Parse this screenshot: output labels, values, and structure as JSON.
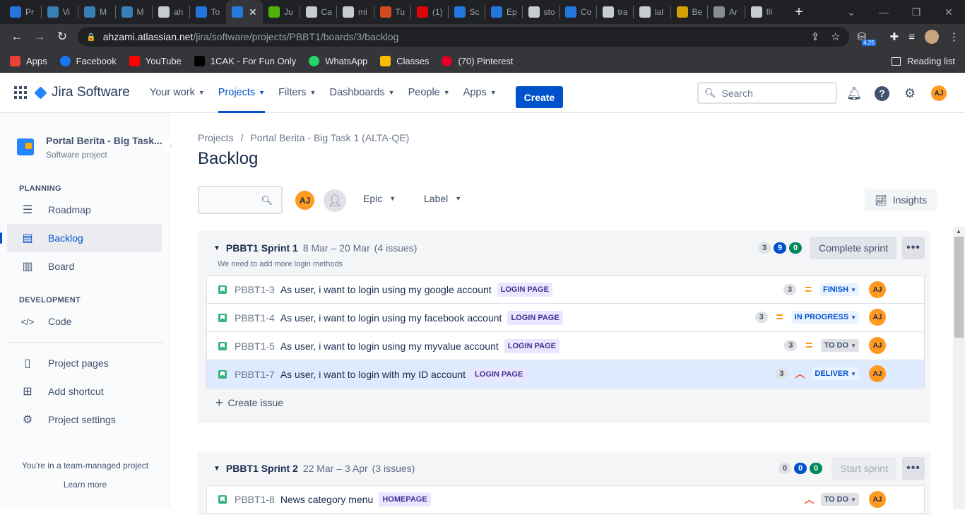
{
  "browser": {
    "tabs": [
      {
        "label": "Pr",
        "icon": "jira-icon",
        "color": "#2684ff"
      },
      {
        "label": "Vi",
        "icon": "m-icon",
        "color": "#3b8fd1"
      },
      {
        "label": "M",
        "icon": "m-icon",
        "color": "#3b8fd1"
      },
      {
        "label": "M",
        "icon": "m-icon",
        "color": "#3b8fd1"
      },
      {
        "label": "ah",
        "icon": "github-icon",
        "color": "#e8eaed"
      },
      {
        "label": "To",
        "icon": "jira-icon",
        "color": "#2684ff"
      },
      {
        "label": "",
        "icon": "jira-icon",
        "color": "#2684ff",
        "active": true
      },
      {
        "label": "Ju",
        "icon": "owl-icon",
        "color": "#58cc02"
      },
      {
        "label": "Ca",
        "icon": "check-icon",
        "color": "#e8eaed"
      },
      {
        "label": "mi",
        "icon": "google-icon",
        "color": "#e8eaed"
      },
      {
        "label": "Tu",
        "icon": "microsoft-icon",
        "color": "#f25022"
      },
      {
        "label": "(1)",
        "icon": "youtube-icon",
        "color": "#ff0000"
      },
      {
        "label": "Sc",
        "icon": "atlassian-icon",
        "color": "#2684ff"
      },
      {
        "label": "Ep",
        "icon": "atlassian-icon",
        "color": "#2684ff"
      },
      {
        "label": "sto",
        "icon": "google-icon",
        "color": "#e8eaed"
      },
      {
        "label": "Co",
        "icon": "atlassian-icon",
        "color": "#2684ff"
      },
      {
        "label": "tra",
        "icon": "google-icon",
        "color": "#e8eaed"
      },
      {
        "label": "lal",
        "icon": "google-icon",
        "color": "#e8eaed"
      },
      {
        "label": "Be",
        "icon": "face-icon",
        "color": "#f4b400"
      },
      {
        "label": "Ar",
        "icon": "globe-icon",
        "color": "#9aa0a6"
      },
      {
        "label": "fil",
        "icon": "google-icon",
        "color": "#e8eaed"
      }
    ],
    "url_host": "ahzami.atlassian.net",
    "url_path": "/jira/software/projects/PBBT1/boards/3/backlog",
    "ext_badge": "4.25",
    "bookmarks": [
      {
        "label": "Apps",
        "icon": "apps-grid-icon",
        "color": "#ea4335"
      },
      {
        "label": "Facebook",
        "icon": "facebook-icon",
        "color": "#1877f2"
      },
      {
        "label": "YouTube",
        "icon": "youtube-icon",
        "color": "#ff0000"
      },
      {
        "label": "1CAK - For Fun Only",
        "icon": "1cak-icon",
        "color": "#000000"
      },
      {
        "label": "WhatsApp",
        "icon": "whatsapp-icon",
        "color": "#25d366"
      },
      {
        "label": "Classes",
        "icon": "classroom-icon",
        "color": "#fbbc04"
      },
      {
        "label": "(70) Pinterest",
        "icon": "pinterest-icon",
        "color": "#e60023"
      }
    ],
    "reading_list": "Reading list"
  },
  "topnav": {
    "product": "Jira Software",
    "menu": [
      {
        "label": "Your work",
        "active": false
      },
      {
        "label": "Projects",
        "active": true
      },
      {
        "label": "Filters",
        "active": false
      },
      {
        "label": "Dashboards",
        "active": false
      },
      {
        "label": "People",
        "active": false
      },
      {
        "label": "Apps",
        "active": false
      }
    ],
    "create": "Create",
    "search_placeholder": "Search",
    "avatar": "AJ"
  },
  "sidebar": {
    "project_name": "Portal Berita - Big Task...",
    "project_type": "Software project",
    "planning_heading": "PLANNING",
    "planning": [
      {
        "label": "Roadmap",
        "icon": "roadmap-icon"
      },
      {
        "label": "Backlog",
        "icon": "backlog-icon",
        "selected": true
      },
      {
        "label": "Board",
        "icon": "board-icon"
      }
    ],
    "development_heading": "DEVELOPMENT",
    "development": [
      {
        "label": "Code",
        "icon": "code-icon"
      }
    ],
    "extra": [
      {
        "label": "Project pages",
        "icon": "page-icon"
      },
      {
        "label": "Add shortcut",
        "icon": "add-shortcut-icon"
      },
      {
        "label": "Project settings",
        "icon": "gear-icon"
      }
    ],
    "team_note": "You're in a team-managed project",
    "learn_more": "Learn more"
  },
  "main": {
    "breadcrumb": [
      "Projects",
      "/",
      "Portal Berita - Big Task 1 (ALTA-QE)"
    ],
    "title": "Backlog",
    "avatar": "AJ",
    "filters": [
      "Epic",
      "Label"
    ],
    "insights": "Insights"
  },
  "sprints": [
    {
      "name": "PBBT1 Sprint 1",
      "dates": "8 Mar – 20 Mar",
      "count": "(4 issues)",
      "goal": "We need to add more login methods",
      "counts": [
        "3",
        "9",
        "0"
      ],
      "action": "Complete sprint",
      "issues": [
        {
          "key": "PBBT1-3",
          "summary": "As user, i want to login using my google account",
          "label": "LOGIN PAGE",
          "points": "3",
          "priority": "medium",
          "status": "FINISH",
          "assignee": "AJ"
        },
        {
          "key": "PBBT1-4",
          "summary": "As user, i want to login using my facebook account",
          "label": "LOGIN PAGE",
          "points": "3",
          "priority": "medium",
          "status": "IN PROGRESS",
          "assignee": "AJ"
        },
        {
          "key": "PBBT1-5",
          "summary": "As user, i want to login using my myvalue account",
          "label": "LOGIN PAGE",
          "points": "3",
          "priority": "medium",
          "status": "TO DO",
          "assignee": "AJ"
        },
        {
          "key": "PBBT1-7",
          "summary": "As user, i want to login with my ID account",
          "label": "LOGIN PAGE",
          "points": "3",
          "priority": "high",
          "status": "DELIVER",
          "assignee": "AJ"
        }
      ],
      "create_issue": "Create issue"
    },
    {
      "name": "PBBT1 Sprint 2",
      "dates": "22 Mar – 3 Apr",
      "count": "(3 issues)",
      "counts": [
        "0",
        "0",
        "0"
      ],
      "action": "Start sprint",
      "issues": [
        {
          "key": "PBBT1-8",
          "summary": "News category menu",
          "label": "HOMEPAGE",
          "points": "",
          "priority": "high",
          "status": "TO DO",
          "assignee": "AJ"
        }
      ]
    }
  ]
}
